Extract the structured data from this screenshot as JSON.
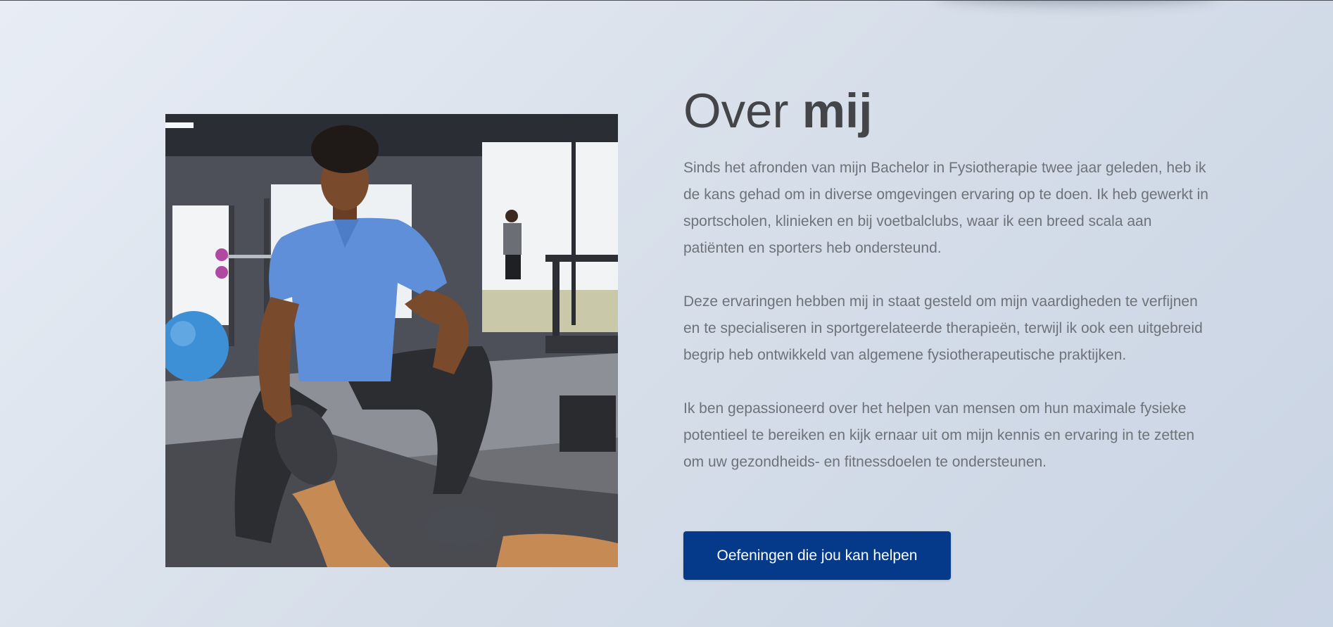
{
  "about": {
    "title_light": "Over",
    "title_bold": "mij",
    "paragraphs": [
      "Sinds het afronden van mijn Bachelor in Fysiotherapie twee jaar geleden, heb ik de kans gehad om in diverse omgevingen ervaring op te doen. Ik heb gewerkt in sportscholen, klinieken en bij voetbalclubs, waar ik een breed scala aan patiënten en sporters heb ondersteund.",
      "Deze ervaringen hebben mij in staat gesteld om mijn vaardigheden te verfijnen en te specialiseren in sportgerelateerde therapieën, terwijl ik ook een uitgebreid begrip heb ontwikkeld van algemene fysiotherapeutische praktijken.",
      "Ik ben gepassioneerd over het helpen van mensen om hun maximale fysieke potentieel te bereiken en kijk ernaar uit om mijn kennis en ervaring in te zetten om uw gezondheids- en fitnessdoelen te ondersteunen."
    ],
    "cta_label": "Oefeningen die jou kan helpen"
  },
  "colors": {
    "button": "#053a8a",
    "heading": "#444548",
    "body_text": "#6e7279"
  }
}
